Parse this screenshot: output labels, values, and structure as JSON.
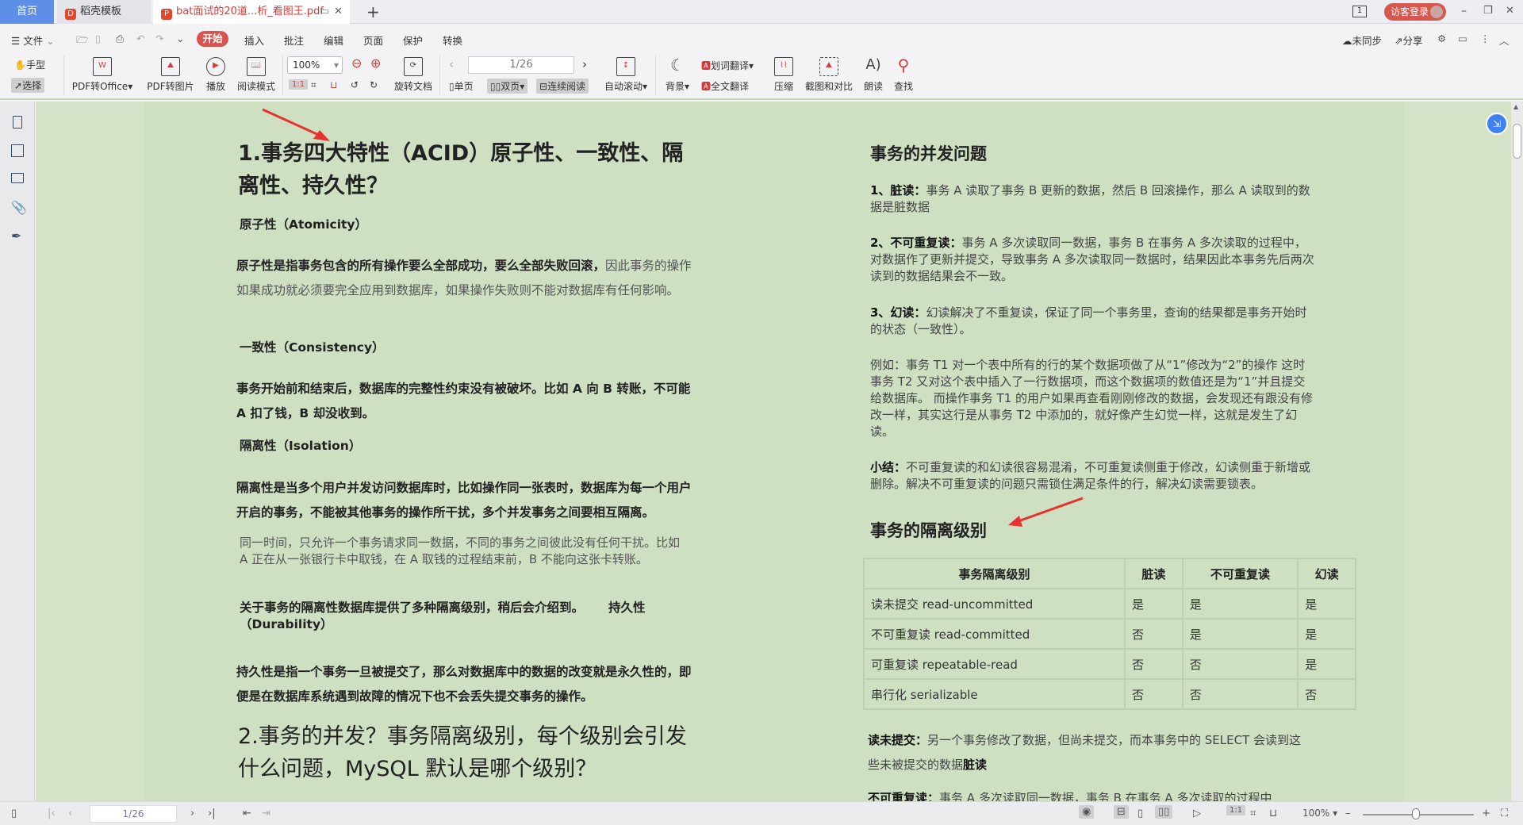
{
  "tabs": {
    "home": "首页",
    "docer": "稻壳模板",
    "pdf": "bat面试的20道...析_看图王.pdf",
    "new_tab": "+"
  },
  "titlebar": {
    "login": "访客登录",
    "minimize": "–",
    "restore": "❐",
    "close": "✕",
    "page_icon": "1"
  },
  "menu": {
    "file": "文件",
    "items": [
      "开始",
      "插入",
      "批注",
      "编辑",
      "页面",
      "保护",
      "转换"
    ],
    "sync": "未同步",
    "share": "分享"
  },
  "toolbar": {
    "hand": "手型",
    "select": "选择",
    "pdf_to_office": "PDF转Office",
    "pdf_to_image": "PDF转图片",
    "play": "播放",
    "read_mode": "阅读模式",
    "zoom": "100%",
    "rotate": "旋转文档",
    "page": "1/26",
    "single": "单页",
    "double": "双页",
    "continuous": "连续阅读",
    "auto_scroll": "自动滚动",
    "background": "背景",
    "word_translate": "划词翻译",
    "full_translate": "全文翻译",
    "compress": "压缩",
    "screenshot_compare": "截图和对比",
    "read_aloud": "朗读",
    "find": "查找"
  },
  "doc": {
    "left": {
      "h1": "1.事务四大特性（ACID）原子性、一致性、隔离性、持久性？",
      "atomicity_title": "原子性（Atomicity）",
      "atomicity_bold": "原子性是指事务包含的所有操作要么全部成功，要么全部失败回滚，",
      "atomicity_rest": "因此事务的操作如果成功就必须要完全应用到数据库，如果操作失败则不能对数据库有任何影响。",
      "consistency_title": "一致性（Consistency）",
      "consistency_text": "事务开始前和结束后，数据库的完整性约束没有被破坏。比如 A 向 B 转账，不可能 A 扣了钱，B 却没收到。",
      "isolation_title": "隔离性（Isolation）",
      "isolation_text": "隔离性是当多个用户并发访问数据库时，比如操作同一张表时，数据库为每一个用户开启的事务，不能被其他事务的操作所干扰，多个并发事务之间要相互隔离。",
      "isolation_example": "同一时间，只允许一个事务请求同一数据，不同的事务之间彼此没有任何干扰。比如 A 正在从一张银行卡中取钱，在 A 取钱的过程结束前，B 不能向这张卡转账。",
      "isolation_note": "关于事务的隔离性数据库提供了多种隔离级别，稍后会介绍到。",
      "durability_title": "持久性（Durability）",
      "durability_text": "持久性是指一个事务一旦被提交了，那么对数据库中的数据的改变就是永久性的，即便是在数据库系统遇到故障的情况下也不会丢失提交事务的操作。",
      "h2": "2.事务的并发？事务隔离级别，每个级别会引发什么问题，MySQL 默认是哪个级别？"
    },
    "right": {
      "concurrency_title": "事务的并发问题",
      "dirty_label": "1、脏读：",
      "dirty_text": "事务 A 读取了事务 B 更新的数据，然后 B 回滚操作，那么 A 读取到的数据是脏数据",
      "nonrepeat_label": "2、不可重复读：",
      "nonrepeat_text": "事务 A 多次读取同一数据，事务 B 在事务 A 多次读取的过程中，对数据作了更新并提交，导致事务 A 多次读取同一数据时，结果因此本事务先后两次读到的数据结果会不一致。",
      "phantom_label": "3、幻读：",
      "phantom_text": "幻读解决了不重复读，保证了同一个事务里，查询的结果都是事务开始时的状态（一致性）。",
      "example": "例如：事务 T1 对一个表中所有的行的某个数据项做了从“1”修改为“2”的操作 这时事务 T2 又对这个表中插入了一行数据项，而这个数据项的数值还是为“1”并且提交给数据库。 而操作事务 T1 的用户如果再查看刚刚修改的数据，会发现还有跟没有修改一样，其实这行是从事务 T2 中添加的，就好像产生幻觉一样，这就是发生了幻读。",
      "summary_label": "小结：",
      "summary_text": "不可重复读的和幻读很容易混淆，不可重复读侧重于修改，幻读侧重于新增或删除。解决不可重复读的问题只需锁住满足条件的行，解决幻读需要锁表。",
      "isolation_levels_title": "事务的隔离级别",
      "table": {
        "headers": [
          "事务隔离级别",
          "脏读",
          "不可重复读",
          "幻读"
        ],
        "rows": [
          [
            "读未提交  read-uncommitted",
            "是",
            "是",
            "是"
          ],
          [
            "不可重复读  read-committed",
            "否",
            "是",
            "是"
          ],
          [
            "可重复读  repeatable-read",
            "否",
            "否",
            "是"
          ],
          [
            "串行化  serializable",
            "否",
            "否",
            "否"
          ]
        ]
      },
      "ru_label": "读未提交：",
      "ru_text": "另一个事务修改了数据，但尚未提交，而本事务中的 SELECT 会读到这些未被提交的数据",
      "ru_bold": "脏读",
      "rc_partial_label": "不可重复读：",
      "rc_partial_text": "事务 A 多次读取同一数据，事务 B 在事务 A 多次读取的过程中"
    }
  },
  "statusbar": {
    "page": "1/26",
    "zoom": "100%"
  },
  "colors": {
    "accent": "#d9534f",
    "page_bg": "#cfdfc2",
    "tab_blue": "#5d8fe8",
    "arrow": "#e8322e"
  }
}
